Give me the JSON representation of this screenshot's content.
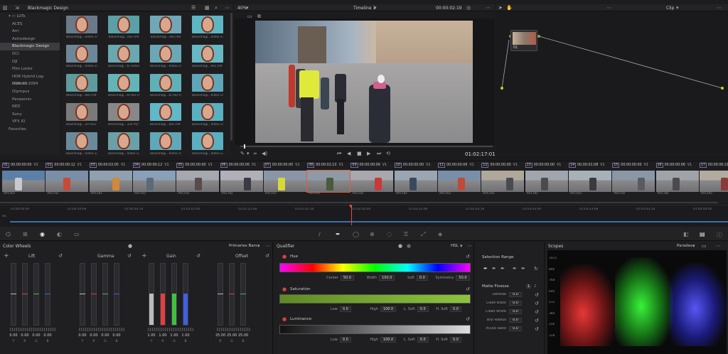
{
  "lut_panel": {
    "title": "Blackmagic Design",
    "root": "LUTs",
    "items": [
      "ACES",
      "Arri",
      "Astrodesign",
      "Blackmagic Design",
      "DCI",
      "DJI",
      "Film Looks",
      "HDR Hybrid Log-Gamma",
      "HDR ST 2084",
      "Olympus",
      "Panasonic",
      "RED",
      "Sony",
      "VFX IO",
      "Favorites"
    ],
    "selected_index": 3
  },
  "lut_thumbs": [
    "Blackmagi...Video v4",
    "Blackmagi...Rec709",
    "Blackmagi...Rec709",
    "Blackmagi...Video v3",
    "Blackmagi...Video v4",
    "Blackmagi...to Video",
    "Blackmagi...Video v4",
    "Blackmagi...Rec709 v2",
    "Blackmagi...Rec709 v3",
    "Blackmagi...to Rec709",
    "Blackmagi...to Rec709",
    "Blackmagi...Video v4",
    "Blackmagi...20 HLG v4",
    "Blackmagi...320 PQ v4",
    "Blackmagi...Rec709 v2",
    "Blackmagi...Video v4",
    "Blackmagi...Video v3",
    "Blackmagi...Video v3",
    "Blackmagi...Video v4",
    "Blackmagi...Video v3"
  ],
  "viewer": {
    "zoom": "40%",
    "timeline_name": "Timeline 1",
    "timecode_top": "00:00:02:19",
    "timecode": "01:02:17:01"
  },
  "nodes": {
    "mode": "Clip",
    "node_label": "01"
  },
  "clips": [
    {
      "num": "01",
      "tc": "00:00:00:00",
      "track": "V1",
      "tag": "AVCHD"
    },
    {
      "num": "02",
      "tc": "00:00:00:12",
      "track": "V1",
      "tag": "AVCHD"
    },
    {
      "num": "03",
      "tc": "00:00:02:05",
      "track": "V1",
      "tag": "AVCHD"
    },
    {
      "num": "04",
      "tc": "00:00:00:12",
      "track": "V1",
      "tag": "AVCHD"
    },
    {
      "num": "05",
      "tc": "00:00:00:00",
      "track": "V1",
      "tag": "AVCHD"
    },
    {
      "num": "06",
      "tc": "00:00:00:06",
      "track": "V1",
      "tag": "AVCHD"
    },
    {
      "num": "07",
      "tc": "00:00:00:00",
      "track": "V1",
      "tag": "AVCHD"
    },
    {
      "num": "08",
      "tc": "00:00:02:13",
      "track": "V1",
      "tag": "AVCHD"
    },
    {
      "num": "09",
      "tc": "00:00:00:06",
      "track": "V1",
      "tag": "AVCHD"
    },
    {
      "num": "10",
      "tc": "00:00:00:00",
      "track": "V1",
      "tag": "AVCHD"
    },
    {
      "num": "11",
      "tc": "00:00:00:06",
      "track": "V1",
      "tag": "AVCHD"
    },
    {
      "num": "12",
      "tc": "00:00:00:00",
      "track": "V1",
      "tag": "AVCHD"
    },
    {
      "num": "13",
      "tc": "00:00:00:00",
      "track": "V1",
      "tag": "AVCHD"
    },
    {
      "num": "14",
      "tc": "00:00:01:08",
      "track": "V1",
      "tag": "AVCHD"
    },
    {
      "num": "15",
      "tc": "00:00:00:00",
      "track": "V1",
      "tag": "AVCHD"
    },
    {
      "num": "16",
      "tc": "00:00:00:06",
      "track": "V1",
      "tag": "AVCHD"
    },
    {
      "num": "17",
      "tc": "00:00:06:21",
      "track": "V1",
      "tag": "AVCHD"
    }
  ],
  "ruler_ticks": [
    "01:00:00:00",
    "01:00:20:08",
    "01:00:40:16",
    "01:01:01:00",
    "01:01:21:08",
    "01:01:41:16",
    "01:02:02:00",
    "01:02:22:08",
    "01:02:42:16",
    "01:03:03:00",
    "01:03:23:08",
    "01:03:43:16",
    "01:04:04:00"
  ],
  "color_wheels": {
    "title": "Color Wheels",
    "mode": "Primaries Bars",
    "wheels": [
      {
        "name": "Lift",
        "values": [
          "0.00",
          "0.00",
          "0.00",
          "0.00"
        ]
      },
      {
        "name": "Gamma",
        "values": [
          "0.00",
          "0.00",
          "0.00",
          "0.00"
        ]
      },
      {
        "name": "Gain",
        "values": [
          "1.00",
          "1.00",
          "1.00",
          "1.00"
        ]
      },
      {
        "name": "Offset",
        "values": [
          "25.00",
          "25.00",
          "25.00"
        ]
      }
    ],
    "channels": [
      "Y",
      "R",
      "G",
      "B"
    ]
  },
  "qualifier": {
    "title": "Qualifier",
    "mode": "HSL",
    "hue": {
      "label": "Hue",
      "center_label": "Center",
      "center": "50.0",
      "width_label": "Width",
      "width": "100.0",
      "soft_label": "Soft",
      "soft": "0.0",
      "sym_label": "Symmetry",
      "sym": "50.0"
    },
    "saturation": {
      "label": "Saturation",
      "low_label": "Low",
      "low": "0.0",
      "high_label": "High",
      "high": "100.0",
      "lsoft_label": "L. Soft",
      "lsoft": "0.0",
      "hsoft_label": "H. Soft",
      "hsoft": "0.0"
    },
    "luminance": {
      "label": "Luminance",
      "low_label": "Low",
      "low": "0.0",
      "high_label": "High",
      "high": "100.0",
      "lsoft_label": "L. Soft",
      "lsoft": "0.0",
      "hsoft_label": "H. Soft",
      "hsoft": "0.0"
    }
  },
  "selection": {
    "title": "Selection Range",
    "finesse_title": "Matte Finesse",
    "page": "1",
    "page2": "2",
    "rows": [
      {
        "label": "Denoise",
        "value": "0.0"
      },
      {
        "label": "Clean Black",
        "value": "0.0"
      },
      {
        "label": "Clean White",
        "value": "0.0"
      },
      {
        "label": "Blur Radius",
        "value": "0.0"
      },
      {
        "label": "In/Out Ratio",
        "value": "0.0"
      }
    ]
  },
  "scopes": {
    "title": "Scopes",
    "mode": "Parades",
    "scale": [
      "1023",
      "896",
      "768",
      "640",
      "512",
      "384",
      "256",
      "128"
    ]
  }
}
